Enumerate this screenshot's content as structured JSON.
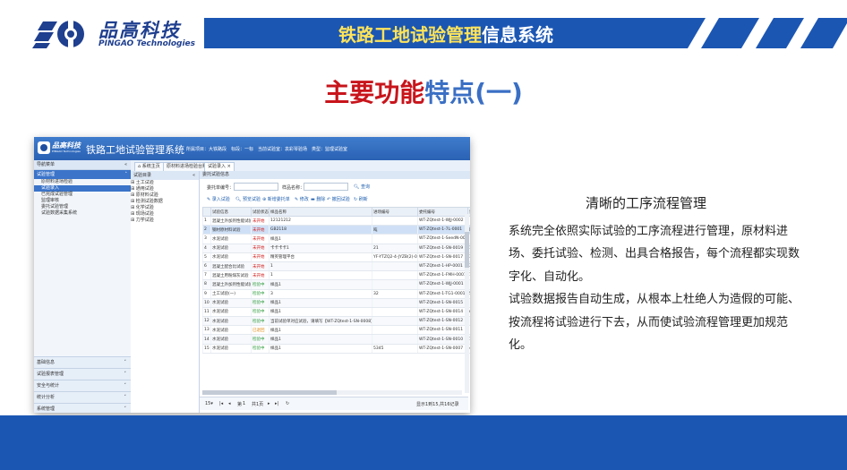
{
  "colors": {
    "brand_blue": "#1b56b3",
    "heading_red": "#c8141b",
    "heading_blue": "#3a6fc4",
    "banner_yellow": "#ffe45a",
    "status_red": "#d21d1d",
    "status_green": "#2a9a3a"
  },
  "brand": {
    "name_cn": "品高科技",
    "name_en": "PINGAO Technologies"
  },
  "banner": {
    "title_part1": "铁路工地试验管理",
    "title_part2": "信息系统"
  },
  "heading": {
    "part1": "主要功能",
    "part2": "特点(一)"
  },
  "screenshot": {
    "brand_cn": "品高科技",
    "brand_en": "PINGAO Technologies",
    "app_title": "铁路工地试验管理系统",
    "header_info": "所属项目：大铁路段　标段：一标　当前试验室：袁彩琴验场　类型：监理试验室",
    "left_nav": {
      "header": "导航菜单",
      "selected_group": "试验管理",
      "items": [
        "原材料进场检验",
        "试验录入",
        "已完成试验管理",
        "监理审核",
        "委托试验管理",
        "试验数据采集系统"
      ],
      "bottom_groups": [
        "基础信息",
        "试验报表管理",
        "安全与统计",
        "统计分析",
        "系统管理"
      ]
    },
    "tabs": [
      "系统主页",
      "原材料进场检验台账",
      "试验录入"
    ],
    "tree": {
      "header": "试验目录",
      "items": [
        "土工试验",
        "通用试验",
        "原材料试验",
        "检测试验数据",
        "化学试验",
        "现场试验",
        "力学试验"
      ]
    },
    "main": {
      "header": "委托试验信息",
      "search": {
        "label1": "委托单编号：",
        "label2": "样品名称：",
        "button": "查询"
      },
      "toolbar": [
        "录入试验",
        "预览试验",
        "新增委托单",
        "修改",
        "删除",
        "撤回试验",
        "刷新"
      ],
      "columns": [
        "",
        "试验信息",
        "试验状态",
        "样品名称",
        "进场编号",
        "委托编号",
        "试验数量",
        "施工"
      ],
      "rows": [
        [
          "1",
          "混凝土外加剂性能试验",
          "未开始",
          "12121212",
          "",
          "WT-ZQtest-1-WJJ-0002",
          "",
          ""
        ],
        [
          "2",
          "钢材原材料试验",
          "未开始",
          "GB2118",
          "吨",
          "WT-ZQtest-1-7L-0001",
          "吨",
          ""
        ],
        [
          "3",
          "水泥试验",
          "未开始",
          "样品1",
          "",
          "WT-ZQtest-1-SeedN-0018",
          "",
          ""
        ],
        [
          "4",
          "水泥试验",
          "未开始",
          "卡卡卡卡1",
          "21",
          "WT-ZQtest-1-SN-0019",
          "1212",
          ""
        ],
        [
          "5",
          "水泥试验",
          "未开始",
          "精英管理平台",
          "YF-YTZQ2-4-JYZB(2)-0620",
          "WT-ZQtest-1-SN-0017",
          "3组",
          "2"
        ],
        [
          "6",
          "混凝土配合比试验",
          "未开始",
          "1",
          "",
          "WT-ZQtest-1-HP-0001",
          "3",
          ""
        ],
        [
          "7",
          "混凝土用粉煤灰试验",
          "未开始",
          "1",
          "",
          "WT-ZQtest-1-FMH-0001",
          "1",
          ""
        ],
        [
          "8",
          "混凝土外加剂性能试验",
          "检验中",
          "样品1",
          "",
          "WT-ZQtest-1-WJJ-0001",
          "",
          ""
        ],
        [
          "9",
          "土工试验(一)",
          "检验中",
          "3",
          "32",
          "WT-ZQtest-1-TG1-0001",
          "5t",
          ""
        ],
        [
          "10",
          "水泥试验",
          "检验中",
          "样品1",
          "",
          "WT-ZQtest-1-SN-0015",
          "",
          ""
        ],
        [
          "11",
          "水泥试验",
          "检验中",
          "样品1",
          "",
          "WT-ZQtest-1-SN-0014",
          "m³",
          ""
        ],
        [
          "12",
          "水泥试验",
          "检验中",
          "当前试验单对应试验，请填写【WT-ZQtest-1-SN-0008】",
          "",
          "WT-ZQtest-1-SN-0012",
          "",
          ""
        ],
        [
          "13",
          "水泥试验",
          "已退回",
          "样品1",
          "",
          "WT-ZQtest-1-SN-0011",
          "",
          ""
        ],
        [
          "14",
          "水泥试验",
          "检验中",
          "样品1",
          "",
          "WT-ZQtest-1-SN-0010",
          "1t",
          ""
        ],
        [
          "15",
          "水泥试验",
          "检验中",
          "样品1",
          "5345",
          "WT-ZQtest-1-SN-0007",
          "456",
          ""
        ]
      ],
      "pager": {
        "page_size": "15",
        "page_prefix": "第",
        "page": "1",
        "page_total": "共1页",
        "summary": "显示1到15,共16记录"
      }
    }
  },
  "features": {
    "title": "清晰的工序流程管理",
    "paragraphs": [
      "系统完全依照实际试验的工序流程进行管理，原材料进场、委托试验、检测、出具合格报告，每个流程都实现数字化、自动化。",
      "试验数据报告自动生成，从根本上杜绝人为造假的可能、按流程将试验进行下去，从而使试验流程管理更加规范化。"
    ]
  }
}
